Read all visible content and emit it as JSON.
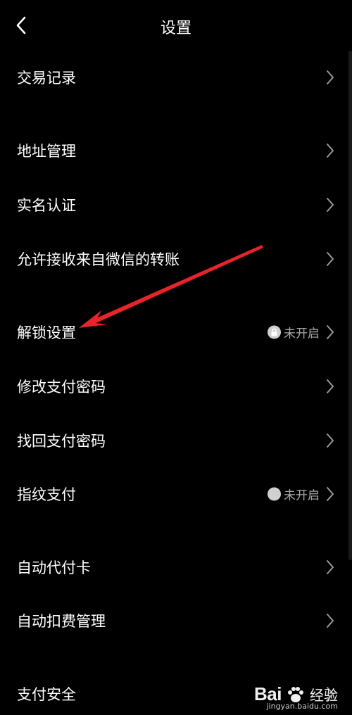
{
  "header": {
    "title": "设置",
    "back_icon": "chevron-left-icon"
  },
  "menu": [
    {
      "label": "交易记录"
    },
    {
      "label": "地址管理"
    },
    {
      "label": "实名认证"
    },
    {
      "label": "允许接收来自微信的转账"
    },
    {
      "label": "解锁设置",
      "status": "未开启",
      "status_icon": "lock-icon"
    },
    {
      "label": "修改支付密码"
    },
    {
      "label": "找回支付密码"
    },
    {
      "label": "指纹支付",
      "status": "未开启",
      "status_icon": "toggle-off-icon"
    },
    {
      "label": "自动代付卡"
    },
    {
      "label": "自动扣费管理"
    },
    {
      "label": "支付安全"
    }
  ],
  "annotation": {
    "color": "#e8232a"
  },
  "watermark": {
    "brand_a": "Bai",
    "brand_b": "经验",
    "url": "jingyan.baidu.com"
  }
}
